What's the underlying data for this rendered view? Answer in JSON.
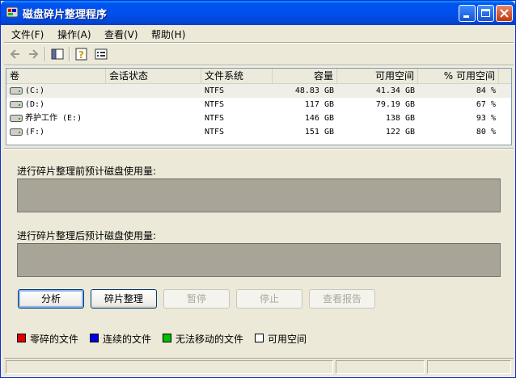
{
  "window": {
    "title": "磁盘碎片整理程序"
  },
  "menu": [
    {
      "label": "文件(F)"
    },
    {
      "label": "操作(A)"
    },
    {
      "label": "查看(V)"
    },
    {
      "label": "帮助(H)"
    }
  ],
  "toolbar": {
    "icons": [
      "back-icon",
      "forward-icon",
      "show-hide-console-tree-icon",
      "help-icon",
      "properties-icon"
    ]
  },
  "volumes": {
    "columns": [
      "卷",
      "会话状态",
      "文件系统",
      "容量",
      "可用空间",
      "% 可用空间"
    ],
    "rows": [
      {
        "name": "(C:)",
        "status": "",
        "fs": "NTFS",
        "capacity": "48.83 GB",
        "free": "41.34 GB",
        "pct": "84 %"
      },
      {
        "name": "(D:)",
        "status": "",
        "fs": "NTFS",
        "capacity": "117 GB",
        "free": "79.19 GB",
        "pct": "67 %"
      },
      {
        "name": "养护工作 (E:)",
        "status": "",
        "fs": "NTFS",
        "capacity": "146 GB",
        "free": "138 GB",
        "pct": "93 %"
      },
      {
        "name": "(F:)",
        "status": "",
        "fs": "NTFS",
        "capacity": "151 GB",
        "free": "122 GB",
        "pct": "80 %"
      }
    ]
  },
  "before_label": "进行碎片整理前预计磁盘使用量:",
  "after_label": "进行碎片整理后预计磁盘使用量:",
  "buttons": {
    "analyze": "分析",
    "defragment": "碎片整理",
    "pause": "暂停",
    "stop": "停止",
    "report": "查看报告"
  },
  "legend": [
    {
      "label": "零碎的文件",
      "color": "#e30000"
    },
    {
      "label": "连续的文件",
      "color": "#0000e0"
    },
    {
      "label": "无法移动的文件",
      "color": "#00c000"
    },
    {
      "label": "可用空间",
      "color": "#ffffff"
    }
  ],
  "colors": {
    "titlebar": "#0050ee",
    "bar_fill": "#a8a598",
    "window_bg": "#ece9d8"
  }
}
